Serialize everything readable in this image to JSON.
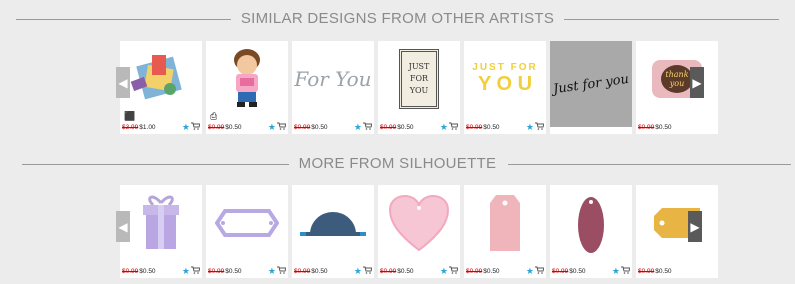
{
  "sections": {
    "similar": {
      "title": "SIMILAR DESIGNS FROM OTHER ARTISTS"
    },
    "more": {
      "title": "MORE FROM SILHOUETTE"
    }
  },
  "icons": {
    "prev": "◀",
    "next": "▶",
    "star": "★",
    "cart": "🛒",
    "cube": "⬛",
    "print": "⎙"
  },
  "similar_items": [
    {
      "name": "3d-card-box",
      "old": "$3.99",
      "price": "$1.00"
    },
    {
      "name": "boy-print-and-cut",
      "old": "$0.99",
      "price": "$0.50"
    },
    {
      "name": "for-you-script",
      "old": "$0.99",
      "price": "$0.50"
    },
    {
      "name": "just-for-you-label",
      "old": "$0.99",
      "price": "$0.50"
    },
    {
      "name": "just-for-you-yellow",
      "old": "$0.99",
      "price": "$0.50"
    },
    {
      "name": "just-for-you-handwritten",
      "old": "",
      "price": ""
    },
    {
      "name": "thank-you-tag",
      "old": "$0.99",
      "price": "$0.50"
    }
  ],
  "more_items": [
    {
      "name": "gift-box",
      "old": "$0.99",
      "price": "$0.50"
    },
    {
      "name": "bracket-label",
      "old": "$0.99",
      "price": "$0.50"
    },
    {
      "name": "half-circle-tab",
      "old": "$0.99",
      "price": "$0.50"
    },
    {
      "name": "heart-tag",
      "old": "$0.99",
      "price": "$0.50"
    },
    {
      "name": "rectangle-tag",
      "old": "$0.99",
      "price": "$0.50"
    },
    {
      "name": "oval-tag",
      "old": "$0.99",
      "price": "$0.50"
    },
    {
      "name": "yellow-tag",
      "old": "$0.99",
      "price": "$0.50"
    }
  ],
  "text_art": {
    "for_you": "For You",
    "just": "JUST",
    "for": "FOR",
    "you": "YOU",
    "just_for": "JUST FOR",
    "you_yellow": "Y O U",
    "handwritten": "Just for you",
    "thank": "thank",
    "you_tag": "you"
  },
  "colors": {
    "strike": "#d40000",
    "star": "#2da5d8"
  }
}
